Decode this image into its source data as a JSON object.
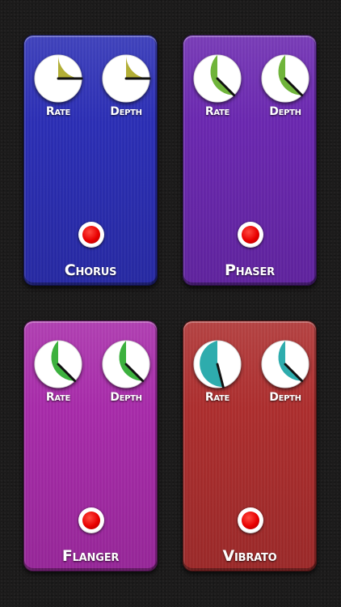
{
  "pedals": [
    {
      "name": "Chorus",
      "color": "#2a2db5",
      "accent": "#b2ae36",
      "knobs": [
        {
          "label": "Rate",
          "value_fraction": 0.25
        },
        {
          "label": "Depth",
          "value_fraction": 0.25
        }
      ],
      "footswitch_led": "#e80000"
    },
    {
      "name": "Phaser",
      "color": "#6a26b0",
      "accent": "#6fb43a",
      "knobs": [
        {
          "label": "Rate",
          "value_fraction": 0.375
        },
        {
          "label": "Depth",
          "value_fraction": 0.375
        }
      ],
      "footswitch_led": "#e80000"
    },
    {
      "name": "Flanger",
      "color": "#a82aaa",
      "accent": "#3cb13e",
      "knobs": [
        {
          "label": "Rate",
          "value_fraction": 0.375
        },
        {
          "label": "Depth",
          "value_fraction": 0.375
        }
      ],
      "footswitch_led": "#e80000"
    },
    {
      "name": "Vibrato",
      "color": "#ad2d2d",
      "accent": "#2eacad",
      "knobs": [
        {
          "label": "Rate",
          "value_fraction": 0.46
        },
        {
          "label": "Depth",
          "value_fraction": 0.375
        }
      ],
      "footswitch_led": "#e80000"
    }
  ]
}
